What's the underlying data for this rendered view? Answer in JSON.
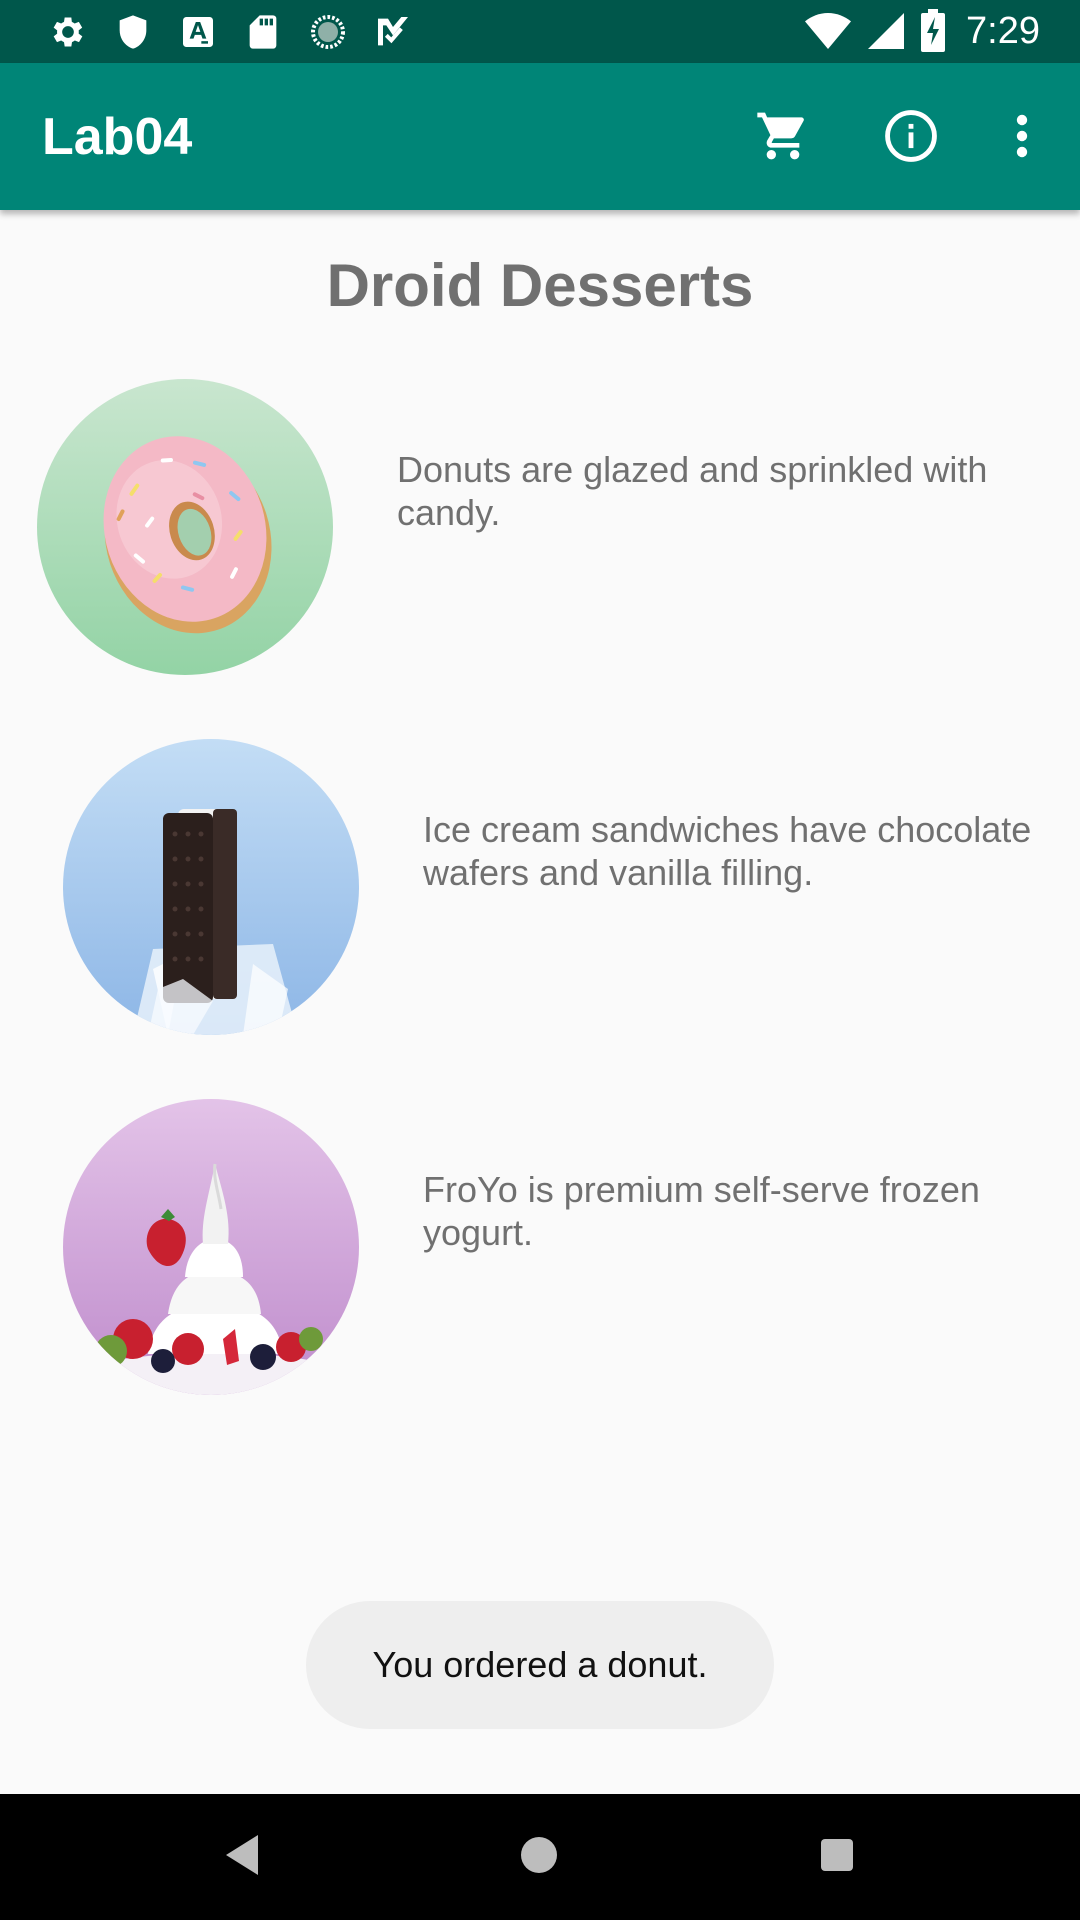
{
  "status_bar": {
    "time": "7:29",
    "left_icons": [
      "settings-icon",
      "shield-icon",
      "font-a-icon",
      "sd-card-icon",
      "sync-circle-icon",
      "task-check-icon"
    ],
    "right_icons": [
      "wifi-icon",
      "cell-signal-icon",
      "battery-charging-icon"
    ]
  },
  "app_bar": {
    "title": "Lab04",
    "actions": [
      "cart-icon",
      "info-icon",
      "overflow-menu-icon"
    ]
  },
  "main": {
    "title": "Droid Desserts",
    "desserts": [
      {
        "image": "donut-image",
        "description": "Donuts are glazed and sprinkled with candy."
      },
      {
        "image": "ice-cream-sandwich-image",
        "description": "Ice cream sandwiches have chocolate wafers and vanilla filling."
      },
      {
        "image": "froyo-image",
        "description": "FroYo is premium self-serve frozen yogurt."
      }
    ]
  },
  "toast": {
    "message": "You ordered a donut."
  },
  "nav_bar": {
    "buttons": [
      "back-icon",
      "home-icon",
      "recents-icon"
    ]
  },
  "colors": {
    "status_bar": "#00574B",
    "app_bar": "#008577",
    "background": "#FAFAFA",
    "text": "#707070"
  }
}
